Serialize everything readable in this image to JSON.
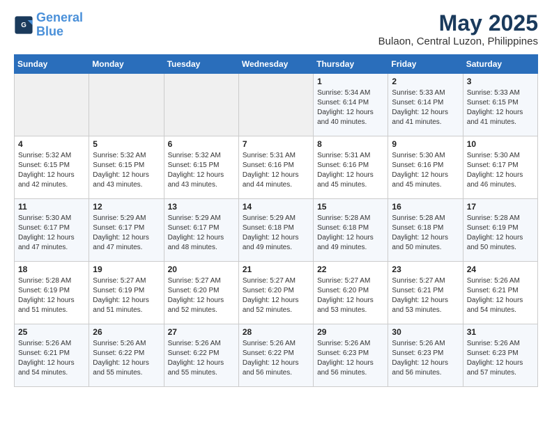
{
  "logo": {
    "line1": "General",
    "line2": "Blue"
  },
  "title": "May 2025",
  "subtitle": "Bulaon, Central Luzon, Philippines",
  "days_header": [
    "Sunday",
    "Monday",
    "Tuesday",
    "Wednesday",
    "Thursday",
    "Friday",
    "Saturday"
  ],
  "weeks": [
    [
      {
        "num": "",
        "info": ""
      },
      {
        "num": "",
        "info": ""
      },
      {
        "num": "",
        "info": ""
      },
      {
        "num": "",
        "info": ""
      },
      {
        "num": "1",
        "info": "Sunrise: 5:34 AM\nSunset: 6:14 PM\nDaylight: 12 hours\nand 40 minutes."
      },
      {
        "num": "2",
        "info": "Sunrise: 5:33 AM\nSunset: 6:14 PM\nDaylight: 12 hours\nand 41 minutes."
      },
      {
        "num": "3",
        "info": "Sunrise: 5:33 AM\nSunset: 6:15 PM\nDaylight: 12 hours\nand 41 minutes."
      }
    ],
    [
      {
        "num": "4",
        "info": "Sunrise: 5:32 AM\nSunset: 6:15 PM\nDaylight: 12 hours\nand 42 minutes."
      },
      {
        "num": "5",
        "info": "Sunrise: 5:32 AM\nSunset: 6:15 PM\nDaylight: 12 hours\nand 43 minutes."
      },
      {
        "num": "6",
        "info": "Sunrise: 5:32 AM\nSunset: 6:15 PM\nDaylight: 12 hours\nand 43 minutes."
      },
      {
        "num": "7",
        "info": "Sunrise: 5:31 AM\nSunset: 6:16 PM\nDaylight: 12 hours\nand 44 minutes."
      },
      {
        "num": "8",
        "info": "Sunrise: 5:31 AM\nSunset: 6:16 PM\nDaylight: 12 hours\nand 45 minutes."
      },
      {
        "num": "9",
        "info": "Sunrise: 5:30 AM\nSunset: 6:16 PM\nDaylight: 12 hours\nand 45 minutes."
      },
      {
        "num": "10",
        "info": "Sunrise: 5:30 AM\nSunset: 6:17 PM\nDaylight: 12 hours\nand 46 minutes."
      }
    ],
    [
      {
        "num": "11",
        "info": "Sunrise: 5:30 AM\nSunset: 6:17 PM\nDaylight: 12 hours\nand 47 minutes."
      },
      {
        "num": "12",
        "info": "Sunrise: 5:29 AM\nSunset: 6:17 PM\nDaylight: 12 hours\nand 47 minutes."
      },
      {
        "num": "13",
        "info": "Sunrise: 5:29 AM\nSunset: 6:17 PM\nDaylight: 12 hours\nand 48 minutes."
      },
      {
        "num": "14",
        "info": "Sunrise: 5:29 AM\nSunset: 6:18 PM\nDaylight: 12 hours\nand 49 minutes."
      },
      {
        "num": "15",
        "info": "Sunrise: 5:28 AM\nSunset: 6:18 PM\nDaylight: 12 hours\nand 49 minutes."
      },
      {
        "num": "16",
        "info": "Sunrise: 5:28 AM\nSunset: 6:18 PM\nDaylight: 12 hours\nand 50 minutes."
      },
      {
        "num": "17",
        "info": "Sunrise: 5:28 AM\nSunset: 6:19 PM\nDaylight: 12 hours\nand 50 minutes."
      }
    ],
    [
      {
        "num": "18",
        "info": "Sunrise: 5:28 AM\nSunset: 6:19 PM\nDaylight: 12 hours\nand 51 minutes."
      },
      {
        "num": "19",
        "info": "Sunrise: 5:27 AM\nSunset: 6:19 PM\nDaylight: 12 hours\nand 51 minutes."
      },
      {
        "num": "20",
        "info": "Sunrise: 5:27 AM\nSunset: 6:20 PM\nDaylight: 12 hours\nand 52 minutes."
      },
      {
        "num": "21",
        "info": "Sunrise: 5:27 AM\nSunset: 6:20 PM\nDaylight: 12 hours\nand 52 minutes."
      },
      {
        "num": "22",
        "info": "Sunrise: 5:27 AM\nSunset: 6:20 PM\nDaylight: 12 hours\nand 53 minutes."
      },
      {
        "num": "23",
        "info": "Sunrise: 5:27 AM\nSunset: 6:21 PM\nDaylight: 12 hours\nand 53 minutes."
      },
      {
        "num": "24",
        "info": "Sunrise: 5:26 AM\nSunset: 6:21 PM\nDaylight: 12 hours\nand 54 minutes."
      }
    ],
    [
      {
        "num": "25",
        "info": "Sunrise: 5:26 AM\nSunset: 6:21 PM\nDaylight: 12 hours\nand 54 minutes."
      },
      {
        "num": "26",
        "info": "Sunrise: 5:26 AM\nSunset: 6:22 PM\nDaylight: 12 hours\nand 55 minutes."
      },
      {
        "num": "27",
        "info": "Sunrise: 5:26 AM\nSunset: 6:22 PM\nDaylight: 12 hours\nand 55 minutes."
      },
      {
        "num": "28",
        "info": "Sunrise: 5:26 AM\nSunset: 6:22 PM\nDaylight: 12 hours\nand 56 minutes."
      },
      {
        "num": "29",
        "info": "Sunrise: 5:26 AM\nSunset: 6:23 PM\nDaylight: 12 hours\nand 56 minutes."
      },
      {
        "num": "30",
        "info": "Sunrise: 5:26 AM\nSunset: 6:23 PM\nDaylight: 12 hours\nand 56 minutes."
      },
      {
        "num": "31",
        "info": "Sunrise: 5:26 AM\nSunset: 6:23 PM\nDaylight: 12 hours\nand 57 minutes."
      }
    ]
  ]
}
